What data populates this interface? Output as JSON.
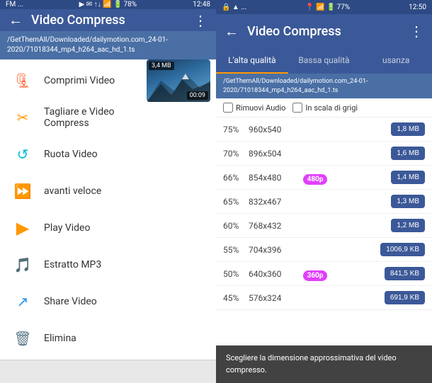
{
  "left": {
    "status_bar": {
      "carrier": "FM ...",
      "time": "12:48",
      "icons": "▶ ✉ ↑↓ 📶 🔋78%"
    },
    "toolbar": {
      "back_icon": "←",
      "title": "Video Compress",
      "more_icon": "⋮"
    },
    "file_path": "/GetThemAll/Downloaded/dailymotion.com_24-01-2020/71018344_mp4_h264_aac_hd_1.ts",
    "menu_items": [
      {
        "icon": "🗜",
        "label": "Comprimi Video",
        "color": "#ff5722"
      },
      {
        "icon": "✂",
        "label": "Tagliare e Video Compress",
        "color": "#ff9800"
      },
      {
        "icon": "🔄",
        "label": "Ruota Video",
        "color": "#00bcd4"
      },
      {
        "icon": "▶▶",
        "label": "avanti veloce",
        "color": "#4caf50"
      },
      {
        "icon": "▶",
        "label": "Play Video",
        "color": "#ff9800"
      },
      {
        "icon": "🎵",
        "label": "Estratto MP3",
        "color": "#e91e63"
      },
      {
        "icon": "↗",
        "label": "Share Video",
        "color": "#2196f3"
      },
      {
        "icon": "🗑",
        "label": "Elimina",
        "color": "#607d8b"
      }
    ],
    "video_thumb": {
      "size": "3,4 MB",
      "duration": "00:09"
    }
  },
  "right": {
    "status_bar": {
      "icons_left": "🔒 ▲",
      "carrier": "...",
      "time": "12:50",
      "icons_right": "📍 🔋77%"
    },
    "toolbar": {
      "back_icon": "←",
      "title": "Video Compress",
      "more_icon": "⋮"
    },
    "tabs": [
      {
        "label": "L'alta qualità",
        "active": true
      },
      {
        "label": "Bassa qualità",
        "active": false
      },
      {
        "label": "usanza",
        "active": false
      }
    ],
    "file_path": "/GetThemAll/Downloaded/dailymotion.com_24-01-2020/71018344_mp4_h264_aac_hd_1.ts",
    "options": {
      "remove_audio": "Rimuovi Audio",
      "grayscale": "In scala di grigi"
    },
    "quality_rows": [
      {
        "pct": "75%",
        "res": "960x540",
        "badge": null,
        "size": "1,8 MB"
      },
      {
        "pct": "70%",
        "res": "896x504",
        "badge": null,
        "size": "1,6 MB"
      },
      {
        "pct": "66%",
        "res": "854x480",
        "badge": "480p",
        "size": "1,4 MB"
      },
      {
        "pct": "65%",
        "res": "832x467",
        "badge": null,
        "size": "1,3 MB"
      },
      {
        "pct": "60%",
        "res": "768x432",
        "badge": null,
        "size": "1,2 MB"
      },
      {
        "pct": "55%",
        "res": "704x396",
        "badge": null,
        "size": "1006,9 KB"
      },
      {
        "pct": "50%",
        "res": "640x360",
        "badge": "360p",
        "size": "841,5 KB"
      },
      {
        "pct": "45%",
        "res": "576x324",
        "badge": null,
        "size": "691,9 KB"
      }
    ],
    "tooltip": "Scegliere la dimensione approssimativa del video compresso."
  }
}
